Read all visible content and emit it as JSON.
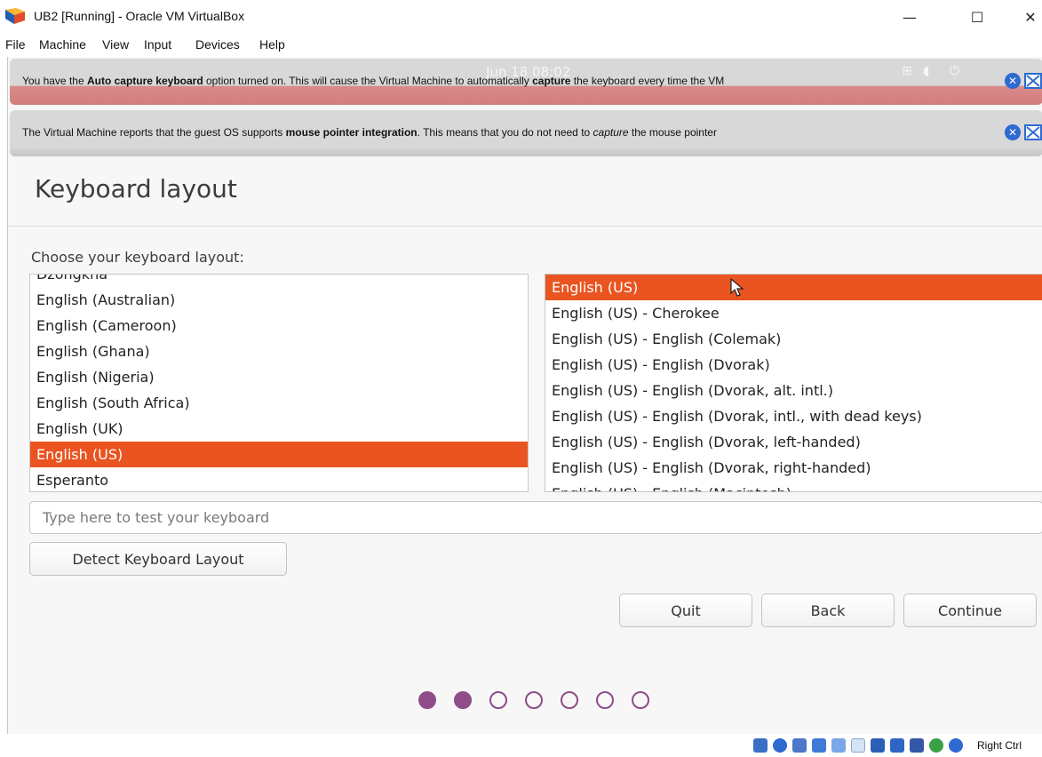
{
  "window": {
    "title": "UB2 [Running] - Oracle VM VirtualBox",
    "minimize_glyph": "—",
    "maximize_glyph": "☐",
    "close_glyph": "✕"
  },
  "menu": [
    "File",
    "Machine",
    "View",
    "Input",
    "Devices",
    "Help"
  ],
  "banners": [
    {
      "segments": [
        {
          "text": "You have the ",
          "bold": false
        },
        {
          "text": "Auto capture keyboard",
          "bold": true
        },
        {
          "text": " option turned on. This will cause the Virtual Machine to automatically ",
          "bold": false
        },
        {
          "text": "capture",
          "bold": true
        },
        {
          "text": " the keyboard every time the VM",
          "bold": false
        }
      ],
      "close_glyph": "✕"
    },
    {
      "segments": [
        {
          "text": "The Virtual Machine reports that the guest OS supports ",
          "bold": false
        },
        {
          "text": "mouse pointer integration",
          "bold": true
        },
        {
          "text": ". This means that you do not need to ",
          "bold": false
        },
        {
          "text": "capture",
          "bold": true,
          "italic": true
        },
        {
          "text": " the mouse pointer",
          "bold": false
        }
      ],
      "close_glyph": "✕"
    }
  ],
  "guest_topbar": {
    "clock": "Jun 18  08:02"
  },
  "installer": {
    "title": "Keyboard layout",
    "prompt": "Choose your keyboard layout:",
    "layouts": [
      "Dzongkha",
      "English (Australian)",
      "English (Cameroon)",
      "English (Ghana)",
      "English (Nigeria)",
      "English (South Africa)",
      "English (UK)",
      "English (US)",
      "Esperanto"
    ],
    "selected_layout": "English (US)",
    "variants": [
      "English (US)",
      "English (US) - Cherokee",
      "English (US) - English (Colemak)",
      "English (US) - English (Dvorak)",
      "English (US) - English (Dvorak, alt. intl.)",
      "English (US) - English (Dvorak, intl., with dead keys)",
      "English (US) - English (Dvorak, left-handed)",
      "English (US) - English (Dvorak, right-handed)",
      "English (US) - English (Macintosh)"
    ],
    "selected_variant": "English (US)",
    "test_placeholder": "Type here to test your keyboard",
    "detect_label": "Detect Keyboard Layout",
    "quit_label": "Quit",
    "back_label": "Back",
    "continue_label": "Continue",
    "steps_total": 7,
    "steps_completed": 2
  },
  "statusbar": {
    "host_key": "Right Ctrl",
    "icons": [
      "hard-disk-icon",
      "optical-drive-icon",
      "audio-icon",
      "network-icon",
      "usb-icon",
      "shared-folders-icon",
      "display-icon",
      "video-capture-icon",
      "cpu-icon",
      "mouse-integration-icon",
      "keyboard-capture-icon"
    ]
  },
  "colors": {
    "accent": "#e95420",
    "step_dot": "#8e4d88",
    "banner_close": "#2d6ad1"
  }
}
